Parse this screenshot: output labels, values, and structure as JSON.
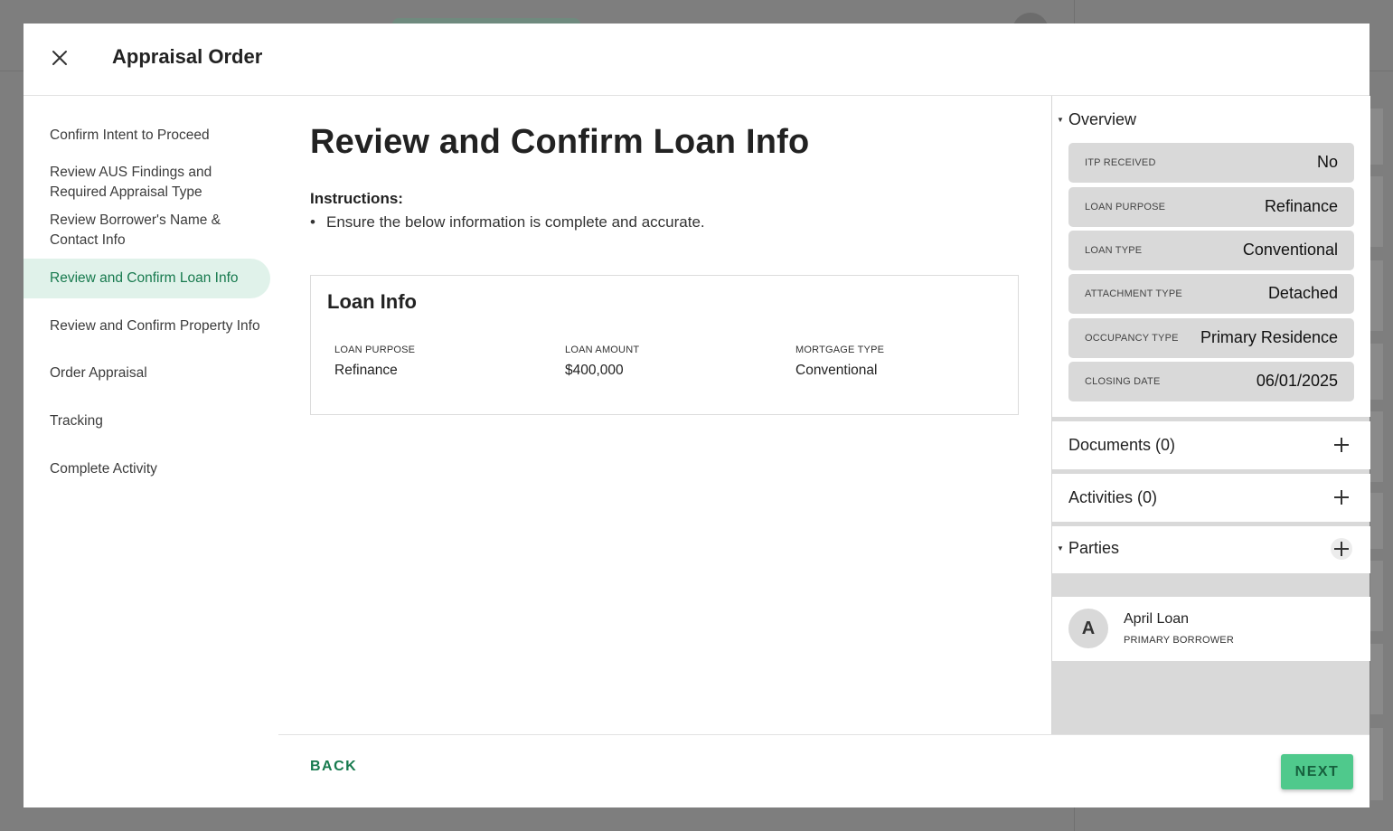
{
  "modal": {
    "title": "Appraisal Order"
  },
  "steps": [
    {
      "label": "Confirm Intent to Proceed"
    },
    {
      "label": "Review AUS Findings and Required Appraisal Type"
    },
    {
      "label": "Review Borrower's Name & Contact Info"
    },
    {
      "label": "Review and Confirm Loan Info",
      "active": true
    },
    {
      "label": "Review and Confirm Property Info"
    },
    {
      "label": "Order Appraisal"
    },
    {
      "label": "Tracking"
    },
    {
      "label": "Complete Activity"
    }
  ],
  "main": {
    "heading": "Review and Confirm Loan Info",
    "instructions_title": "Instructions:",
    "instructions": [
      "Ensure the below information is complete and accurate."
    ],
    "card": {
      "title": "Loan Info",
      "fields": [
        {
          "label": "LOAN PURPOSE",
          "value": "Refinance"
        },
        {
          "label": "LOAN AMOUNT",
          "value": "$400,000"
        },
        {
          "label": "MORTGAGE TYPE",
          "value": "Conventional"
        }
      ]
    }
  },
  "footer": {
    "back_label": "BACK",
    "next_label": "NEXT"
  },
  "sidebar": {
    "overview": {
      "title": "Overview",
      "rows": [
        {
          "key": "ITP RECEIVED",
          "value": "No"
        },
        {
          "key": "LOAN PURPOSE",
          "value": "Refinance"
        },
        {
          "key": "LOAN TYPE",
          "value": "Conventional"
        },
        {
          "key": "ATTACHMENT TYPE",
          "value": "Detached"
        },
        {
          "key": "OCCUPANCY TYPE",
          "value": "Primary Residence"
        },
        {
          "key": "CLOSING DATE",
          "value": "06/01/2025"
        }
      ]
    },
    "documents": {
      "title": "Documents (0)"
    },
    "activities": {
      "title": "Activities (0)"
    },
    "parties": {
      "title": "Parties",
      "items": [
        {
          "initial": "A",
          "name": "April Loan",
          "role": "PRIMARY BORROWER"
        }
      ]
    }
  },
  "colors": {
    "accent": "#177a4e",
    "active_step_bg": "#e0f2ea",
    "next_button": "#4fc98c"
  }
}
